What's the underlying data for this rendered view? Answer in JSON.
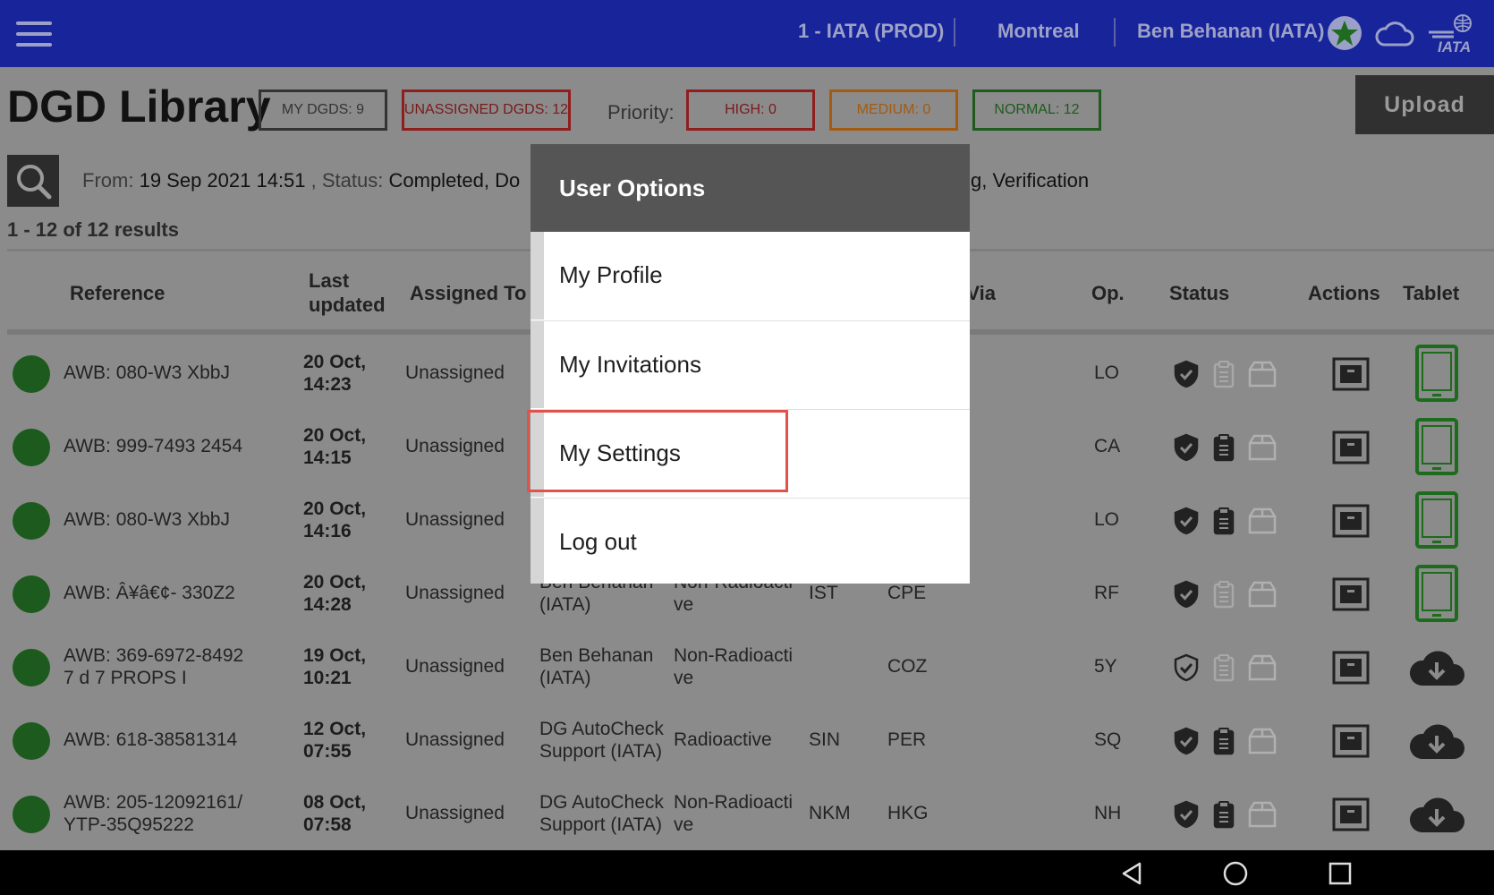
{
  "topbar": {
    "environment": "1 - IATA (PROD)",
    "location": "Montreal",
    "user": "Ben Behanan (IATA)",
    "icons": [
      "menu-icon",
      "star-icon",
      "cloud-icon",
      "iata-logo"
    ],
    "bg_color": "#17249a"
  },
  "page": {
    "title": "DGD Library",
    "my_dgds": "MY DGDS: 9",
    "unassigned_dgds": "UNASSIGNED DGDS: 12",
    "priority_label": "Priority:",
    "high": "HIGH: 0",
    "medium": "MEDIUM: 0",
    "normal": "NORMAL: 12",
    "upload": "Upload",
    "filter_from_label": "From:",
    "filter_from_value": "19 Sep 2021 14:51",
    "filter_status_label": ", Status:",
    "filter_status_value": "Completed, Do",
    "filter_tail": "g, Verification",
    "results": "1 - 12 of 12 results"
  },
  "table": {
    "columns": [
      "Reference",
      "Last\nupdated",
      "Assigned To",
      "Via",
      "Op.",
      "Status",
      "Actions",
      "Tablet"
    ],
    "rows": [
      {
        "reference": "AWB: 080-W3 XbbJ",
        "updated": "20 Oct,\n14:23",
        "assigned": "Unassigned",
        "user": "",
        "type": "",
        "origin": "",
        "dest": "",
        "op": "LO",
        "status_full": true,
        "tablet": "tablet"
      },
      {
        "reference": "AWB: 999-7493 2454",
        "updated": "20 Oct,\n14:15",
        "assigned": "Unassigned",
        "user": "",
        "type": "",
        "origin": "",
        "dest": "",
        "op": "CA",
        "status_full": true,
        "tablet": "tablet"
      },
      {
        "reference": "AWB: 080-W3 XbbJ",
        "updated": "20 Oct,\n14:16",
        "assigned": "Unassigned",
        "user": "",
        "type": "",
        "origin": "",
        "dest": "",
        "op": "LO",
        "status_full": true,
        "tablet": "tablet"
      },
      {
        "reference": "AWB: Â¥â€¢- 330Z2",
        "updated": "20 Oct,\n14:28",
        "assigned": "Unassigned",
        "user": "Ben Behanan\n(IATA)",
        "type": "Non-Radioacti\nve",
        "origin": "IST",
        "dest": "CPE",
        "op": "RF",
        "status_full": true,
        "tablet": "tablet"
      },
      {
        "reference": "AWB: 369-6972-8492\n7 d 7 PROPS I",
        "updated": "19 Oct,\n10:21",
        "assigned": "Unassigned",
        "user": "Ben Behanan\n(IATA)",
        "type": "Non-Radioacti\nve",
        "origin": "",
        "dest": "COZ",
        "op": "5Y",
        "status_full": false,
        "tablet": "download"
      },
      {
        "reference": "AWB: 618-38581314",
        "updated": "12 Oct,\n07:55",
        "assigned": "Unassigned",
        "user": "DG AutoCheck\nSupport (IATA)",
        "type": "Radioactive",
        "origin": "SIN",
        "dest": "PER",
        "op": "SQ",
        "status_full": true,
        "tablet": "download"
      },
      {
        "reference": "AWB: 205-12092161/\nYTP-35Q95222",
        "updated": "08 Oct,\n07:58",
        "assigned": "Unassigned",
        "user": "DG AutoCheck\nSupport (IATA)",
        "type": "Non-Radioacti\nve",
        "origin": "NKM",
        "dest": "HKG",
        "op": "NH",
        "status_full": true,
        "tablet": "download"
      }
    ]
  },
  "menu": {
    "title": "User Options",
    "items": [
      "My Profile",
      "My Invitations",
      "My Settings",
      "Log out"
    ],
    "highlighted": "My Settings",
    "highlight_color": "#e0524a"
  },
  "colors": {
    "high": "#7a1a1a",
    "medium": "#a35a12",
    "normal": "#1f5a1f",
    "green_dot": "#1d5a1d",
    "tablet_green": "#1d6b1d"
  }
}
